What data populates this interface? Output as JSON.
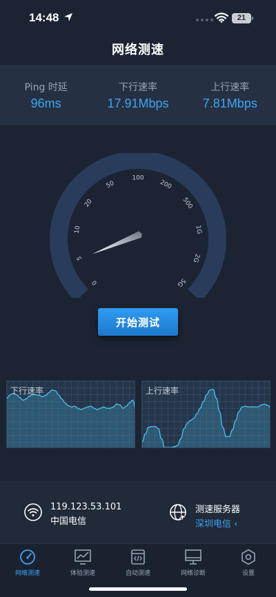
{
  "status_bar": {
    "time": "14:48",
    "battery": "21"
  },
  "header": {
    "title": "网络测速"
  },
  "metrics": [
    {
      "label": "Ping 时延",
      "value": "96ms"
    },
    {
      "label": "下行速率",
      "value": "17.91Mbps"
    },
    {
      "label": "上行速率",
      "value": "7.81Mbps"
    }
  ],
  "gauge": {
    "ticks": [
      "0",
      "5",
      "10",
      "20",
      "50",
      "100",
      "200",
      "500",
      "1G",
      "2G",
      "5G"
    ],
    "needle_value": "5"
  },
  "start_button": {
    "label": "开始测试"
  },
  "charts": {
    "download": {
      "label": "下行速率",
      "values": [
        0.75,
        0.8,
        0.82,
        0.8,
        0.76,
        0.72,
        0.74,
        0.78,
        0.8,
        0.8,
        0.79,
        0.77,
        0.79,
        0.83,
        0.87,
        0.86,
        0.8,
        0.74,
        0.68,
        0.64,
        0.62,
        0.63,
        0.6,
        0.58,
        0.6,
        0.62,
        0.63,
        0.6,
        0.58,
        0.6,
        0.62,
        0.6,
        0.6,
        0.62,
        0.66,
        0.65,
        0.6,
        0.63,
        0.68,
        0.72,
        0.58
      ]
    },
    "upload": {
      "label": "上行速率",
      "values": [
        0.1,
        0.22,
        0.32,
        0.33,
        0.33,
        0.3,
        0.15,
        0.02,
        0.02,
        0.02,
        0.03,
        0.05,
        0.15,
        0.3,
        0.38,
        0.42,
        0.45,
        0.52,
        0.6,
        0.7,
        0.8,
        0.87,
        0.88,
        0.75,
        0.55,
        0.32,
        0.18,
        0.18,
        0.28,
        0.42,
        0.55,
        0.62,
        0.63,
        0.62,
        0.62,
        0.62,
        0.62,
        0.65,
        0.66,
        0.64,
        0.6
      ]
    }
  },
  "connection": {
    "ip": "119.123.53.101",
    "isp": "中国电信"
  },
  "server": {
    "title": "测速服务器",
    "name": "深圳电信 ‹"
  },
  "tabs": [
    {
      "label": "网络测速",
      "icon": "speedometer-icon",
      "active": true
    },
    {
      "label": "体验测速",
      "icon": "trend-monitor-icon",
      "active": false
    },
    {
      "label": "自动测速",
      "icon": "code-doc-icon",
      "active": false
    },
    {
      "label": "网络诊断",
      "icon": "monitor-icon",
      "active": false
    },
    {
      "label": "设置",
      "icon": "gear-icon",
      "active": false
    }
  ],
  "colors": {
    "accent": "#3fa4f3",
    "background": "#1c2433",
    "panel": "#253042",
    "chart_line": "#4cc3f5"
  }
}
